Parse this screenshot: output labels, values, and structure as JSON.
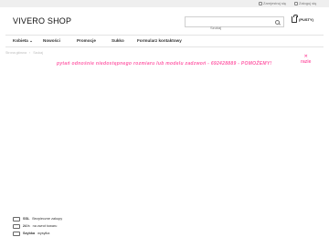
{
  "topbar": {
    "register": "Zarejestruj się",
    "login": "Zaloguj się"
  },
  "header": {
    "logo": "VIVERO SHOP",
    "search_placeholder": "Szukaj",
    "cart_label": "(PUSTY)"
  },
  "nav": {
    "items": [
      "Kobieta",
      "Nowości",
      "Promocje",
      "Sukko",
      "Formularz kontaktowy"
    ]
  },
  "breadcrumb": [
    "Strona główna",
    "Szukaj"
  ],
  "banner": {
    "text": "pytań odnośnie niedostępnego rozmiaru lub modelu zadzwoń - 692428889 - POMOŻEMY!",
    "close_arrow": "✕",
    "close_label": "razie"
  },
  "features": [
    {
      "bold": "SSL",
      "text": "Bezpieczne zakupy"
    },
    {
      "bold": "24 h",
      "text": "na zwrot towaru"
    },
    {
      "bold": "Szybka",
      "text": "wysyłka"
    }
  ],
  "colors": {
    "accent": "#ff5fa8",
    "topbar_bg": "#efefef"
  }
}
